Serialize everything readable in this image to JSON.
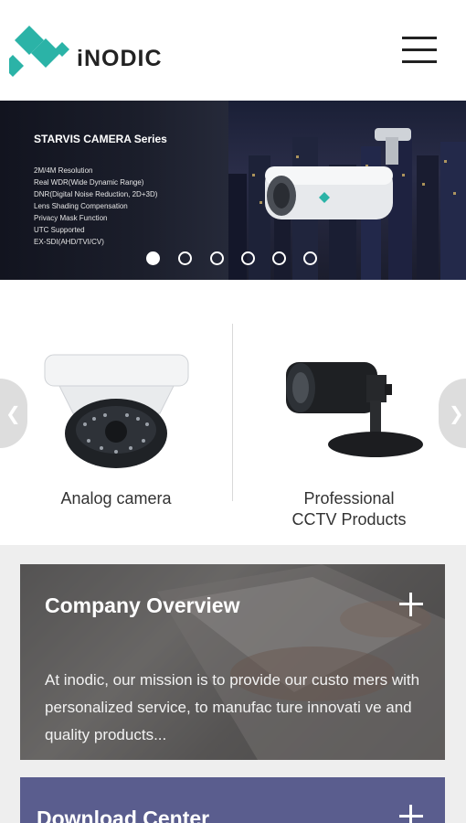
{
  "header": {
    "logo_text": "iNODIC",
    "logo_color": "#2bb3a7",
    "menu_icon": "hamburger-icon"
  },
  "banner": {
    "title": "STARVIS CAMERA Series",
    "features": [
      "2M/4M Resolution",
      "Real WDR(Wide Dynamic Range)",
      "DNR(Digital Noise Reduction, 2D+3D)",
      "Lens Shading Compensation",
      "Privacy Mask Function",
      "UTC Supported",
      "EX-SDI(AHD/TVI/CV)"
    ],
    "slide_count": 6,
    "active_slide": 0
  },
  "products": {
    "items": [
      {
        "label": "Analog camera"
      },
      {
        "label_line1": "Professional",
        "label_line2": "CCTV Products"
      }
    ],
    "prev_icon": "chevron-left-icon",
    "next_icon": "chevron-right-icon"
  },
  "cards": {
    "company": {
      "title": "Company Overview",
      "text": "At inodic, our mission is to provide our custo mers with personalized service, to manufac ture innovati ve and quality products..."
    },
    "download": {
      "title": "Download Center",
      "color": "#5a5d8e"
    }
  }
}
